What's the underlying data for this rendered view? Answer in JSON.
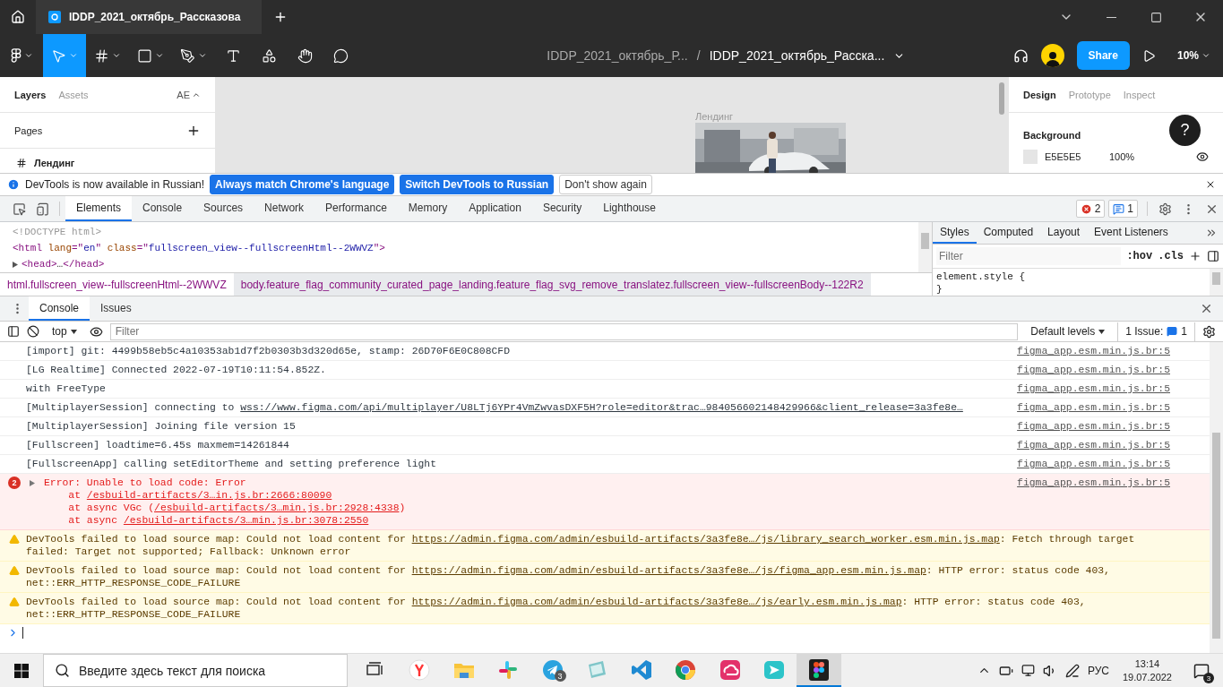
{
  "figma_tabbar": {
    "tab_title": "IDDP_2021_октябрь_Рассказова"
  },
  "figma_toolbar": {
    "tools": [
      {
        "kind": "main-menu",
        "selected": false,
        "caret": true
      },
      {
        "kind": "move",
        "selected": true,
        "caret": true
      },
      {
        "kind": "frame",
        "selected": false,
        "caret": true
      },
      {
        "kind": "shape",
        "selected": false,
        "caret": true
      },
      {
        "kind": "pen",
        "selected": false,
        "caret": true
      },
      {
        "kind": "text",
        "selected": false,
        "caret": false
      },
      {
        "kind": "resources",
        "selected": false,
        "caret": false
      },
      {
        "kind": "hand",
        "selected": false,
        "caret": false
      },
      {
        "kind": "comment",
        "selected": false,
        "caret": false
      }
    ],
    "file_path": "IDDP_2021_октябрь_Р...",
    "separator": "/",
    "file_name": "IDDP_2021_октябрь_Расска...",
    "share": "Share",
    "zoom": "10%"
  },
  "left_panel": {
    "tabs": [
      {
        "label": "Layers",
        "selected": true
      },
      {
        "label": "Assets",
        "selected": false
      }
    ],
    "library": "AE",
    "pages_title": "Pages",
    "pages": [
      {
        "name": "Лендинг"
      }
    ]
  },
  "canvas": {
    "frame_label": "Лендинг"
  },
  "right_panel": {
    "tabs": [
      {
        "label": "Design",
        "selected": true
      },
      {
        "label": "Prototype",
        "selected": false
      },
      {
        "label": "Inspect",
        "selected": false
      }
    ],
    "help": "?",
    "background_title": "Background",
    "color_hex": "E5E5E5",
    "opacity": "100%"
  },
  "infobar": {
    "message": "DevTools is now available in Russian!",
    "buttons": [
      {
        "label": "Always match Chrome's language",
        "kind": "primary"
      },
      {
        "label": "Switch DevTools to Russian",
        "kind": "primary"
      },
      {
        "label": "Don't show again",
        "kind": "secondary"
      }
    ]
  },
  "devtools_tabs": [
    {
      "label": "Elements",
      "selected": true
    },
    {
      "label": "Console",
      "selected": false
    },
    {
      "label": "Sources",
      "selected": false
    },
    {
      "label": "Network",
      "selected": false
    },
    {
      "label": "Performance",
      "selected": false
    },
    {
      "label": "Memory",
      "selected": false
    },
    {
      "label": "Application",
      "selected": false
    },
    {
      "label": "Security",
      "selected": false
    },
    {
      "label": "Lighthouse",
      "selected": false
    }
  ],
  "error_count": "2",
  "info_count": "1",
  "elements": {
    "lines": [
      {
        "expandable": false,
        "parts": [
          {
            "kind": "doctype",
            "text": "<!DOCTYPE html>"
          }
        ]
      },
      {
        "expandable": false,
        "parts": [
          {
            "kind": "tag",
            "text": "<html "
          },
          {
            "kind": "attr",
            "text": "lang"
          },
          {
            "kind": "tag",
            "text": "=\""
          },
          {
            "kind": "value",
            "text": "en"
          },
          {
            "kind": "tag",
            "text": "\" "
          },
          {
            "kind": "attr",
            "text": "class"
          },
          {
            "kind": "tag",
            "text": "=\""
          },
          {
            "kind": "value",
            "text": "fullscreen_view--fullscreenHtml--2WWVZ"
          },
          {
            "kind": "tag",
            "text": "\">"
          }
        ]
      },
      {
        "expandable": true,
        "parts": [
          {
            "kind": "tag",
            "text": "<head>"
          },
          {
            "kind": "plain",
            "text": "…"
          },
          {
            "kind": "tag",
            "text": "</head>"
          }
        ]
      }
    ]
  },
  "breadcrumbs": [
    {
      "text": "html.fullscreen_view--fullscreenHtml--2WWVZ",
      "selected": false
    },
    {
      "text": "body.feature_flag_community_curated_page_landing.feature_flag_svg_remove_translatez.fullscreen_view--fullscreenBody--122R2",
      "selected": true
    }
  ],
  "styles": {
    "tabs": [
      {
        "label": "Styles",
        "selected": true
      },
      {
        "label": "Computed",
        "selected": false
      },
      {
        "label": "Layout",
        "selected": false
      },
      {
        "label": "Event Listeners",
        "selected": false
      }
    ],
    "filter_placeholder": "Filter",
    "hov": ":hov",
    "cls": ".cls",
    "rule": "element.style {",
    "rule_end": "}"
  },
  "drawer_tabs": [
    {
      "label": "Console",
      "selected": true
    },
    {
      "label": "Issues",
      "selected": false
    }
  ],
  "console_toolbar": {
    "context": "top",
    "filter_placeholder": "Filter",
    "levels": "Default levels",
    "issues": "1 Issue:",
    "issue_count": "1"
  },
  "messages": [
    {
      "kind": "log",
      "source": "figma_app.esm.min.js.br:5",
      "lines": [
        [
          {
            "text": "[import] git: 4499b58eb5c4a10353ab1d7f2b0303b3d320d65e, stamp: 26D70F6E0C808CFD",
            "link": false
          }
        ]
      ]
    },
    {
      "kind": "log",
      "source": "figma_app.esm.min.js.br:5",
      "lines": [
        [
          {
            "text": "[LG Realtime] Connected 2022-07-19T10:11:54.852Z.",
            "link": false
          }
        ]
      ]
    },
    {
      "kind": "log",
      "source": "figma_app.esm.min.js.br:5",
      "lines": [
        [
          {
            "text": "with FreeType",
            "link": false
          }
        ]
      ]
    },
    {
      "kind": "log",
      "source": "figma_app.esm.min.js.br:5",
      "lines": [
        [
          {
            "text": "[MultiplayerSession] connecting to ",
            "link": false
          },
          {
            "text": "wss://www.figma.com/api/multiplayer/U8LTj6YPr4VmZwvasDXF5H?role=editor&trac…984056602148429966&client_release=3a3fe8e…",
            "link": true
          }
        ]
      ]
    },
    {
      "kind": "log",
      "source": "figma_app.esm.min.js.br:5",
      "lines": [
        [
          {
            "text": "[MultiplayerSession] Joining file version 15",
            "link": false
          }
        ]
      ]
    },
    {
      "kind": "log",
      "source": "figma_app.esm.min.js.br:5",
      "lines": [
        [
          {
            "text": "[Fullscreen] loadtime=6.45s maxmem=14261844",
            "link": false
          }
        ]
      ]
    },
    {
      "kind": "log",
      "source": "figma_app.esm.min.js.br:5",
      "lines": [
        [
          {
            "text": "[FullscreenApp] calling setEditorTheme and setting preference light",
            "link": false
          }
        ]
      ]
    },
    {
      "kind": "error",
      "count": "2",
      "source": "figma_app.esm.min.js.br:5",
      "lines": [
        [
          {
            "text": "Error: Unable to load code: Error",
            "link": false
          }
        ],
        [
          {
            "text": "    at ",
            "link": false
          },
          {
            "text": "/esbuild-artifacts/3…in.js.br:2666:80090",
            "link": true
          }
        ],
        [
          {
            "text": "    at async VGc (",
            "link": false
          },
          {
            "text": "/esbuild-artifacts/3…min.js.br:2928:4338",
            "link": true
          },
          {
            "text": ")",
            "link": false
          }
        ],
        [
          {
            "text": "    at async ",
            "link": false
          },
          {
            "text": "/esbuild-artifacts/3…min.js.br:3078:2550",
            "link": true
          }
        ]
      ]
    },
    {
      "kind": "warning",
      "lines": [
        [
          {
            "text": "DevTools failed to load source map: Could not load content for ",
            "link": false
          },
          {
            "text": "https://admin.figma.com/admin/esbuild-artifacts/3a3fe8e…/js/library_search_worker.esm.min.js.map",
            "link": true
          },
          {
            "text": ": Fetch through target failed: Target not supported; Fallback: Unknown error",
            "link": false
          }
        ]
      ]
    },
    {
      "kind": "warning",
      "lines": [
        [
          {
            "text": "DevTools failed to load source map: Could not load content for ",
            "link": false
          },
          {
            "text": "https://admin.figma.com/admin/esbuild-artifacts/3a3fe8e…/js/figma_app.esm.min.js.map",
            "link": true
          },
          {
            "text": ": HTTP error: status code 403, net::ERR_HTTP_RESPONSE_CODE_FAILURE",
            "link": false
          }
        ]
      ]
    },
    {
      "kind": "warning",
      "lines": [
        [
          {
            "text": "DevTools failed to load source map: Could not load content for ",
            "link": false
          },
          {
            "text": "https://admin.figma.com/admin/esbuild-artifacts/3a3fe8e…/js/early.esm.min.js.map",
            "link": true
          },
          {
            "text": ": HTTP error: status code 403, net::ERR_HTTP_RESPONSE_CODE_FAILURE",
            "link": false
          }
        ]
      ]
    }
  ],
  "taskbar": {
    "search_placeholder": "Введите здесь текст для поиска",
    "apps": [
      {
        "kind": "task-view",
        "active": false
      },
      {
        "kind": "yandex",
        "active": false
      },
      {
        "kind": "explorer",
        "active": false
      },
      {
        "kind": "slack",
        "active": false
      },
      {
        "kind": "telegram",
        "active": false,
        "badge": "3"
      },
      {
        "kind": "notes",
        "active": false
      },
      {
        "kind": "vscode",
        "active": false
      },
      {
        "kind": "chrome",
        "active": false
      },
      {
        "kind": "creative-cloud",
        "active": false
      },
      {
        "kind": "sender",
        "active": false
      },
      {
        "kind": "figma",
        "active": true
      }
    ],
    "language": "РУС",
    "time": "13:14",
    "date": "19.07.2022",
    "notifications": "3"
  }
}
